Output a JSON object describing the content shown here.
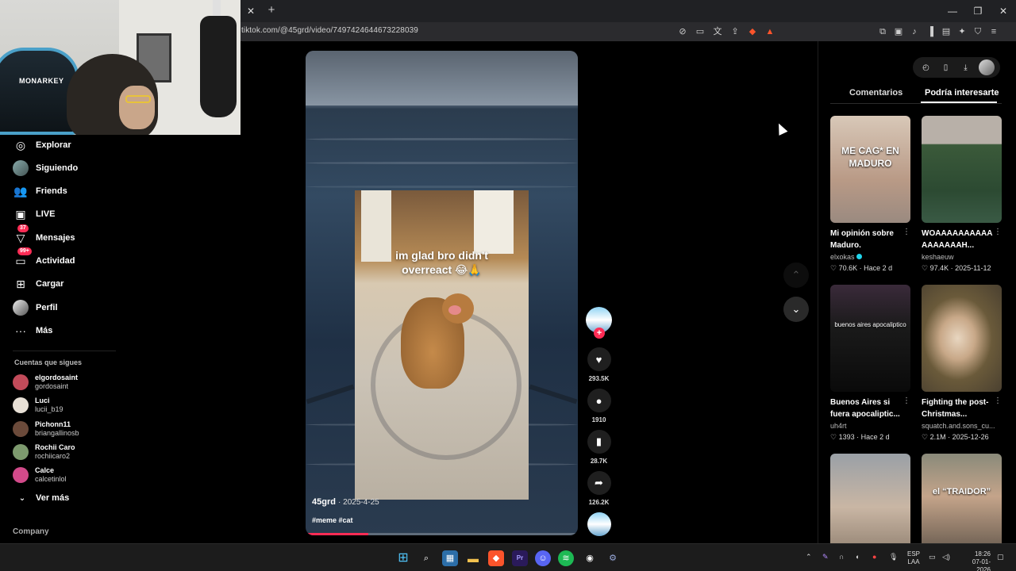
{
  "browser": {
    "url": "tiktok.com/@45grd/video/7497424644673228039",
    "tab_close": "✕",
    "tab_new": "+",
    "window_buttons": [
      "—",
      "❐",
      "✕"
    ]
  },
  "webcam": {
    "chair_text": "MONARKEY"
  },
  "sidebar": {
    "items": [
      {
        "label": "Explorar",
        "icon": "compass-icon"
      },
      {
        "label": "Siguiendo",
        "icon": "following-avatar-icon"
      },
      {
        "label": "Friends",
        "icon": "friends-icon"
      },
      {
        "label": "LIVE",
        "icon": "live-icon"
      },
      {
        "label": "Mensajes",
        "icon": "messages-icon",
        "badge": "37"
      },
      {
        "label": "Actividad",
        "icon": "activity-icon",
        "badge": "99+"
      },
      {
        "label": "Cargar",
        "icon": "upload-icon"
      },
      {
        "label": "Perfil",
        "icon": "profile-avatar-icon"
      },
      {
        "label": "Más",
        "icon": "more-icon"
      }
    ],
    "following_header": "Cuentas que sigues",
    "accounts": [
      {
        "name": "elgordosaint",
        "handle": "gordosaint",
        "color": "#c24b5a"
      },
      {
        "name": "Luci",
        "handle": "lucii_b19",
        "color": "#e8e0d6"
      },
      {
        "name": "Pichonn11",
        "handle": "briangallinosb",
        "color": "#6b4a3a"
      },
      {
        "name": "Rochii Caro",
        "handle": "rochiicaro2",
        "color": "#7d9a6e"
      },
      {
        "name": "Calce",
        "handle": "calcetinlol",
        "color": "#d24a8a"
      }
    ],
    "see_more": "Ver más",
    "company": "Company"
  },
  "video": {
    "caption": "im glad bro didn't\noverreact 😂🙏",
    "author": "45grd",
    "date": "· 2025-4-25",
    "tags": "#meme #cat",
    "progress": 0.23
  },
  "actions": {
    "likes": "293.5K",
    "comments": "1910",
    "saves": "28.7K",
    "shares": "126.2K",
    "follow_plus": "+"
  },
  "right_panel": {
    "tabs": [
      "Comentarios",
      "Podría interesarte"
    ],
    "active_tab": "Podría interesarte",
    "cards": [
      {
        "title": "Mi opinión sobre Maduro.",
        "author": "elxokas",
        "verified": true,
        "likes": "70.6K",
        "when": "Hace 2 d",
        "thumb_text": "ME CAG* EN MADURO"
      },
      {
        "title": "WOAAAAAAAAAA AAAAAAAH...",
        "author": "keshaeuw",
        "likes": "97.4K",
        "when": "2025-11-12"
      },
      {
        "title": "Buenos Aires si fuera apocaliptic...",
        "author": "uh4rt",
        "likes": "1393",
        "when": "Hace 2 d",
        "thumb_text": "buenos aires apocaliptico"
      },
      {
        "title": "Fighting the post-Christmas...",
        "author": "squatch.and.sons_cu...",
        "likes": "2.1M",
        "when": "2025-12-26"
      },
      {
        "title": "",
        "author": "",
        "likes": "",
        "when": ""
      },
      {
        "title": "",
        "author": "",
        "likes": "",
        "when": "",
        "thumb_text": "el “TRAIDOR”"
      }
    ]
  },
  "taskbar": {
    "lang_line1": "ESP",
    "lang_line2": "LAA",
    "time": "18:26",
    "date": "07-01-2026"
  }
}
